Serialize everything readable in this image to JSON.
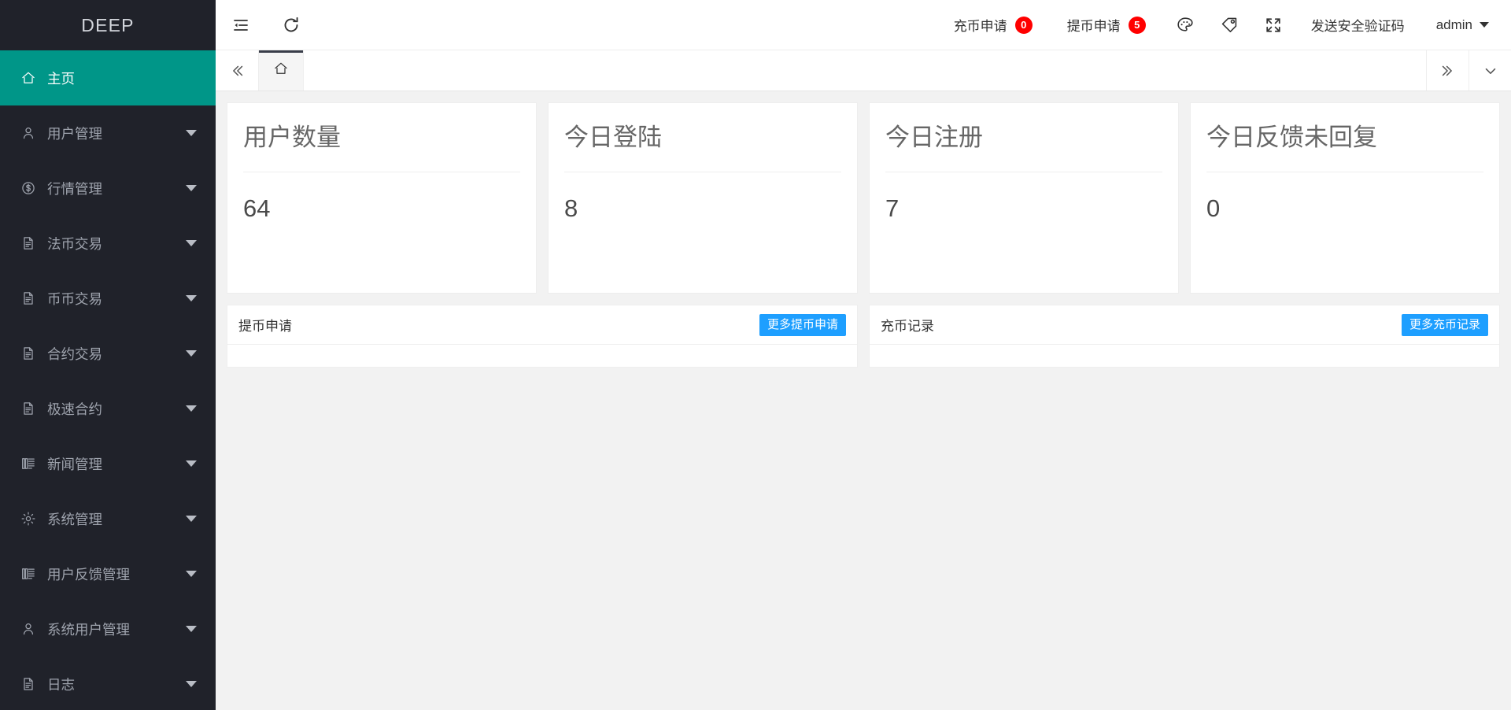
{
  "sidebar": {
    "brand": "DEEP",
    "items": [
      {
        "label": "主页",
        "icon": "home-icon",
        "active": true,
        "caret": false
      },
      {
        "label": "用户管理",
        "icon": "user-icon",
        "active": false,
        "caret": true
      },
      {
        "label": "行情管理",
        "icon": "dollar-icon",
        "active": false,
        "caret": true
      },
      {
        "label": "法币交易",
        "icon": "document-icon",
        "active": false,
        "caret": true
      },
      {
        "label": "币币交易",
        "icon": "document-icon",
        "active": false,
        "caret": true
      },
      {
        "label": "合约交易",
        "icon": "document-icon",
        "active": false,
        "caret": true
      },
      {
        "label": "极速合约",
        "icon": "document-icon",
        "active": false,
        "caret": true
      },
      {
        "label": "新闻管理",
        "icon": "news-icon",
        "active": false,
        "caret": true
      },
      {
        "label": "系统管理",
        "icon": "gear-icon",
        "active": false,
        "caret": true
      },
      {
        "label": "用户反馈管理",
        "icon": "news-icon",
        "active": false,
        "caret": true
      },
      {
        "label": "系统用户管理",
        "icon": "user-icon",
        "active": false,
        "caret": true
      },
      {
        "label": "日志",
        "icon": "document-icon",
        "active": false,
        "caret": true
      }
    ]
  },
  "topbar": {
    "menu_toggle_icon": "menu-collapse-icon",
    "refresh_icon": "refresh-icon",
    "deposit_request": {
      "label": "充币申请",
      "badge": "0"
    },
    "withdraw_request": {
      "label": "提币申请",
      "badge": "5"
    },
    "theme_icon": "palette-icon",
    "tag_icon": "tag-icon",
    "fullscreen_icon": "fullscreen-icon",
    "send_code_label": "发送安全验证码",
    "user_label": "admin"
  },
  "tabbar": {
    "prev_icon": "chevrons-left-icon",
    "next_icon": "chevrons-right-icon",
    "dropdown_icon": "chevron-down-icon",
    "tabs": [
      {
        "icon": "home-icon",
        "active": true
      }
    ]
  },
  "stats": [
    {
      "title": "用户数量",
      "value": "64"
    },
    {
      "title": "今日登陆",
      "value": "8"
    },
    {
      "title": "今日注册",
      "value": "7"
    },
    {
      "title": "今日反馈未回复",
      "value": "0"
    }
  ],
  "panels": [
    {
      "title": "提币申请",
      "button": "更多提币申请"
    },
    {
      "title": "充币记录",
      "button": "更多充币记录"
    }
  ],
  "colors": {
    "accent": "#009688",
    "sidebar_bg": "#20222a",
    "badge_red": "#ff0000",
    "button_blue": "#1E9FFF",
    "tab_indicator": "#393d49"
  }
}
